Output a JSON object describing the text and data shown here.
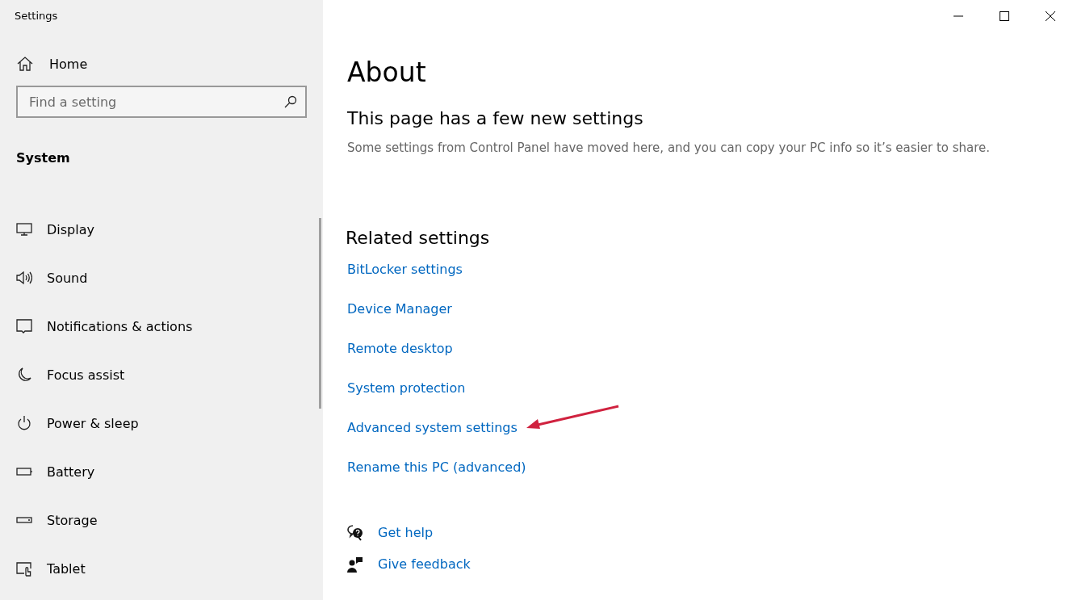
{
  "window": {
    "title": "Settings"
  },
  "sidebar": {
    "home": {
      "label": "Home"
    },
    "search": {
      "placeholder": "Find a setting"
    },
    "section": "System",
    "items": [
      {
        "label": "Display",
        "kind": "display"
      },
      {
        "label": "Sound",
        "kind": "sound"
      },
      {
        "label": "Notifications & actions",
        "kind": "notifications"
      },
      {
        "label": "Focus assist",
        "kind": "focus"
      },
      {
        "label": "Power & sleep",
        "kind": "power"
      },
      {
        "label": "Battery",
        "kind": "battery"
      },
      {
        "label": "Storage",
        "kind": "storage"
      },
      {
        "label": "Tablet",
        "kind": "tablet"
      }
    ]
  },
  "page": {
    "title": "About",
    "notice": {
      "heading": "This page has a few new settings",
      "text": "Some settings from Control Panel have moved here, and you can copy your PC info so it’s easier to share."
    },
    "related": {
      "heading": "Related settings",
      "links": [
        "BitLocker settings",
        "Device Manager",
        "Remote desktop",
        "System protection",
        "Advanced system settings",
        "Rename this PC (advanced)"
      ]
    },
    "help": [
      {
        "label": "Get help",
        "kind": "help"
      },
      {
        "label": "Give feedback",
        "kind": "feedback"
      }
    ]
  }
}
